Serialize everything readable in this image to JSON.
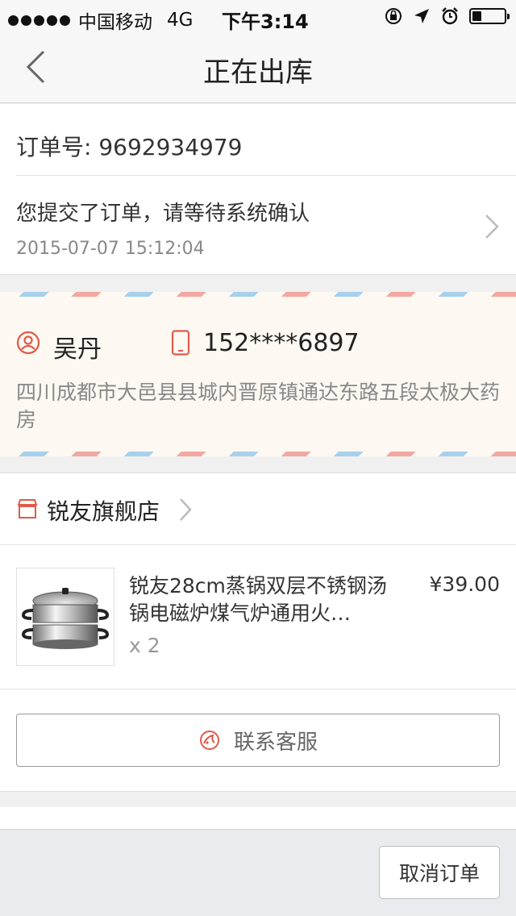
{
  "status_bar": {
    "carrier": "中国移动",
    "network": "4G",
    "time": "下午3:14",
    "signal_bars": 5,
    "battery_level": 0.3,
    "icons": [
      "orientation-lock-icon",
      "location-arrow-icon",
      "alarm-icon",
      "battery-icon"
    ]
  },
  "nav": {
    "title": "正在出库",
    "back_icon": "chevron-left-icon"
  },
  "order": {
    "number_label": "订单号: 9692934979",
    "status_message": "您提交了订单，请等待系统确认",
    "status_time": "2015-07-07 15:12:04"
  },
  "address": {
    "name": "吴丹",
    "phone": "152****6897",
    "full_address": "四川成都市大邑县县城内晋原镇通达东路五段太极大药房",
    "colors": {
      "stripe_red": "#f3a7a1",
      "stripe_blue": "#a7d0ec",
      "accent": "#e05a4a"
    }
  },
  "shop": {
    "name": "锐友旗舰店"
  },
  "product": {
    "title": "锐友28cm蒸锅双层不锈钢汤锅电磁炉煤气炉通用火…",
    "quantity": "x 2",
    "price": "¥39.00",
    "thumbnail_icon": "steamer-pot-image"
  },
  "actions": {
    "contact_service": "联系客服",
    "cancel_order": "取消订单"
  }
}
